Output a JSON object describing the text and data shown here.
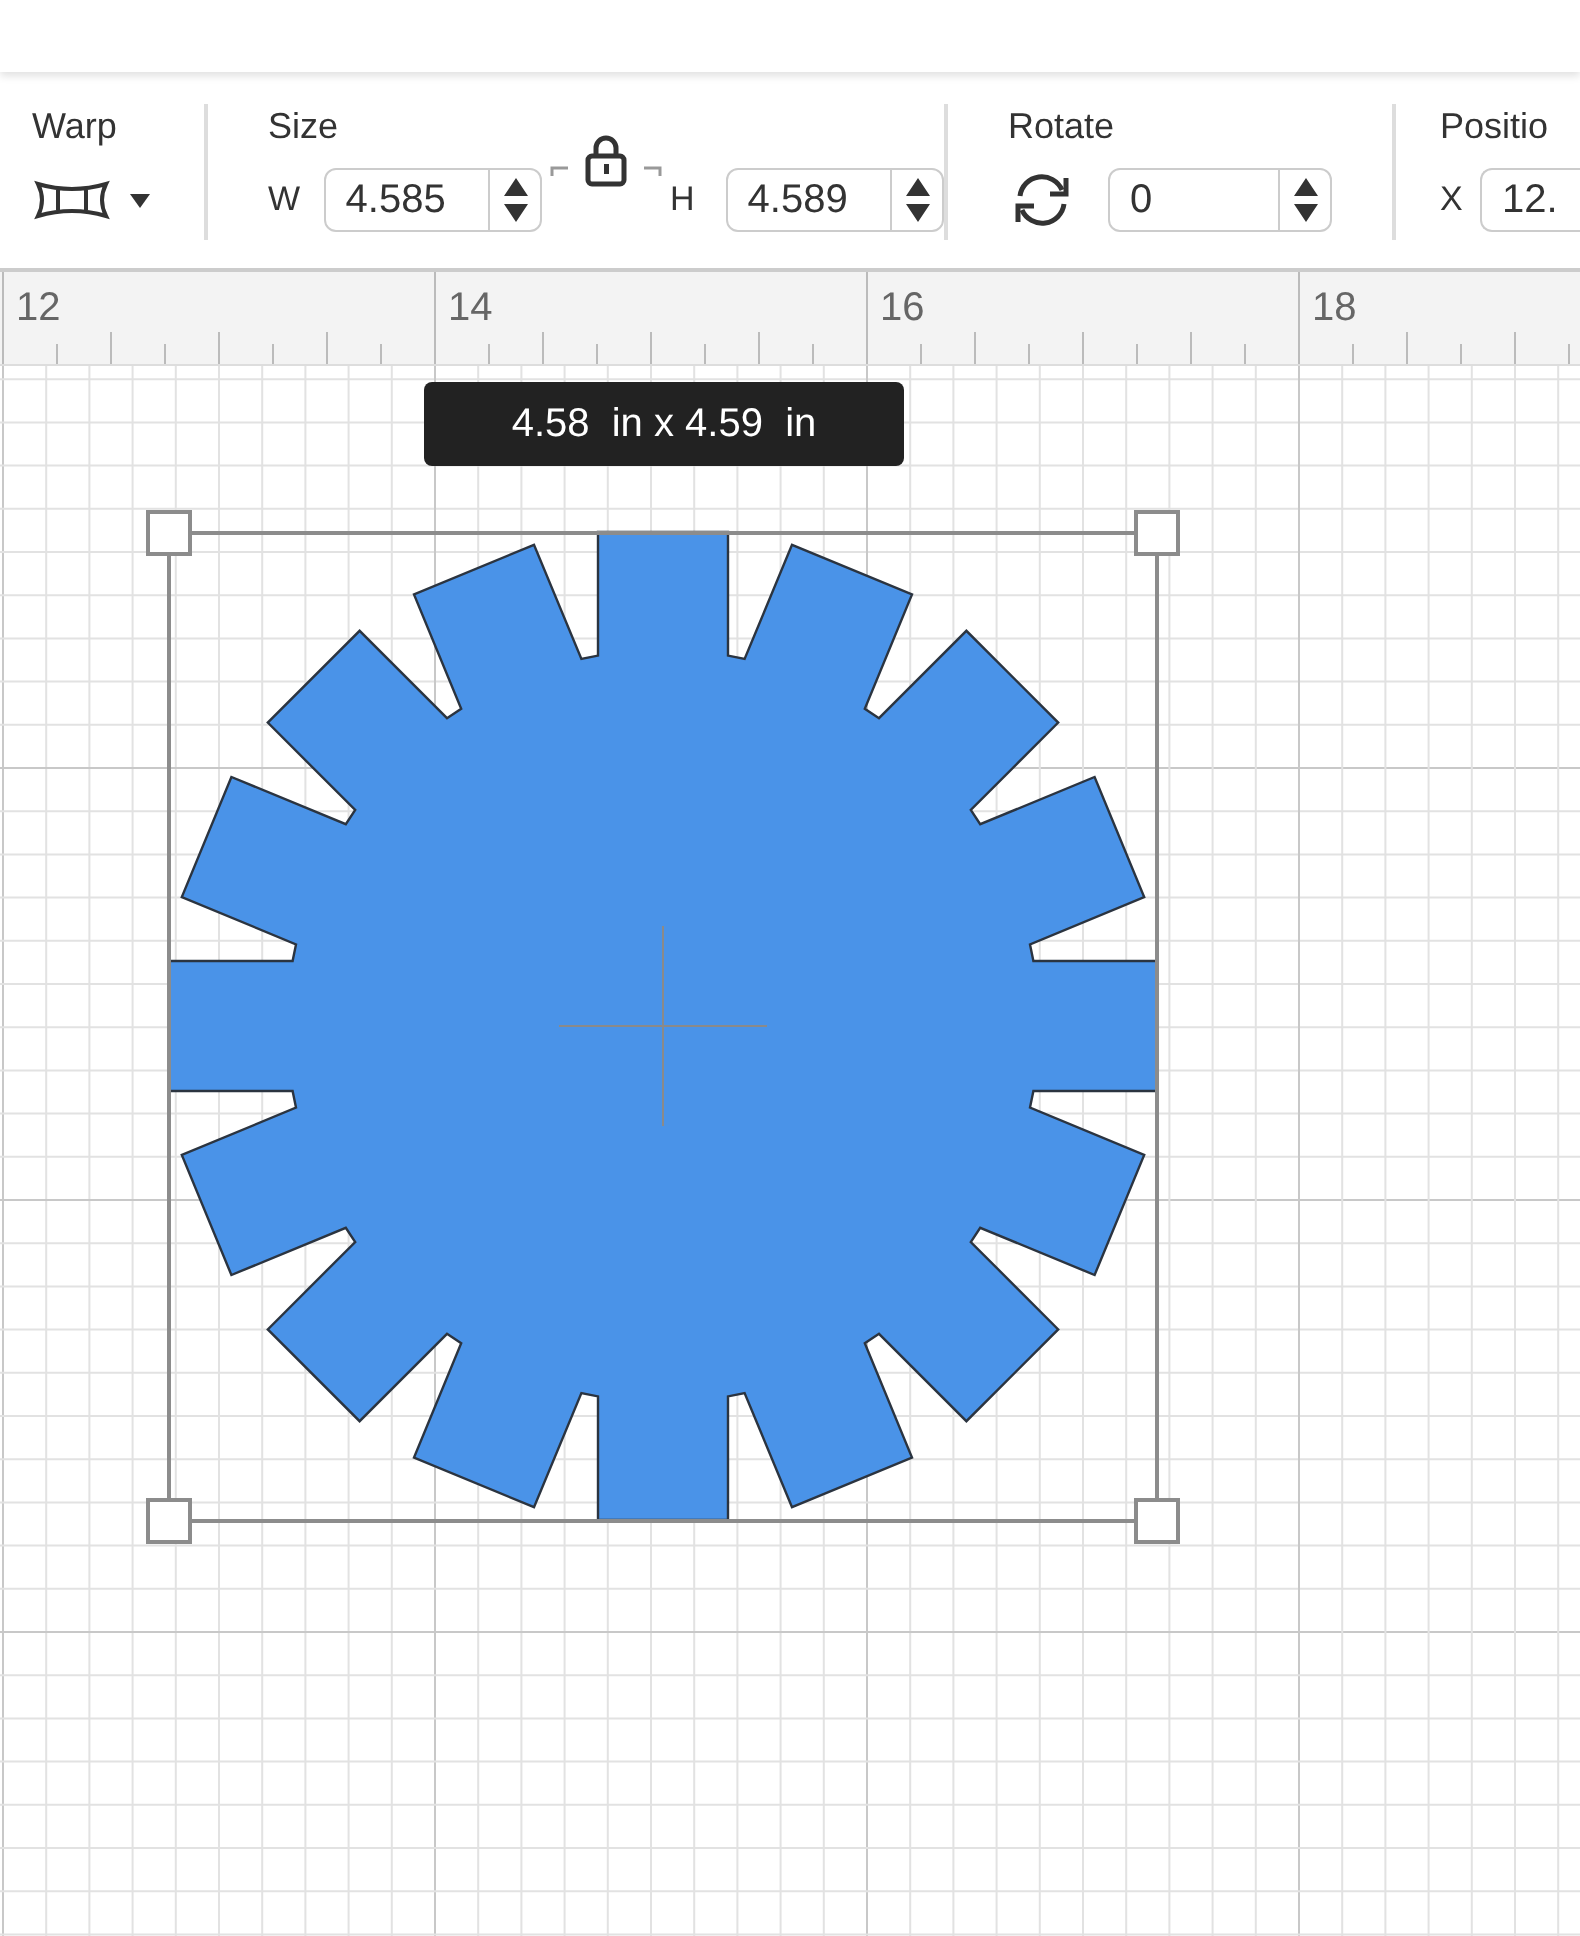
{
  "toolbar": {
    "warp": {
      "label": "Warp"
    },
    "size": {
      "label": "Size",
      "locked": true,
      "width": {
        "label": "W",
        "value": "4.585"
      },
      "height": {
        "label": "H",
        "value": "4.589"
      }
    },
    "rotate": {
      "label": "Rotate",
      "value": "0"
    },
    "position": {
      "label": "Positio",
      "x": {
        "label": "X",
        "value": "12."
      }
    }
  },
  "ruler": {
    "labels": [
      "12",
      "14",
      "16",
      "18"
    ]
  },
  "canvas": {
    "selected": true,
    "tooltip": "4.58  in x 4.59  in"
  }
}
